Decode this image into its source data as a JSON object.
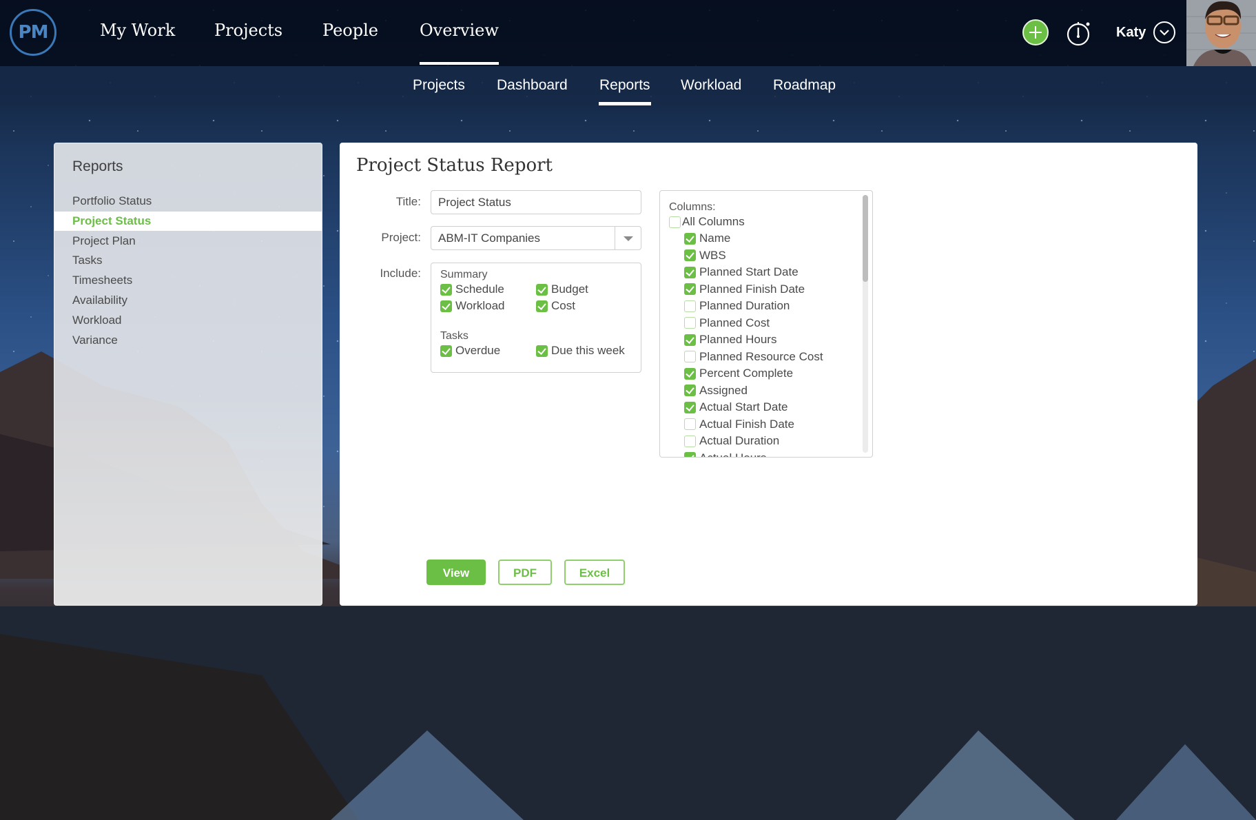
{
  "brand": {
    "logo_text": "PM",
    "accent": "#6cbf45"
  },
  "main_nav": [
    {
      "label": "My Work",
      "active": false
    },
    {
      "label": "Projects",
      "active": false
    },
    {
      "label": "People",
      "active": false
    },
    {
      "label": "Overview",
      "active": true
    }
  ],
  "sub_nav": [
    {
      "label": "Projects",
      "active": false
    },
    {
      "label": "Dashboard",
      "active": false
    },
    {
      "label": "Reports",
      "active": true
    },
    {
      "label": "Workload",
      "active": false
    },
    {
      "label": "Roadmap",
      "active": false
    }
  ],
  "header_actions": {
    "add_icon": "plus-circle-icon",
    "timer_icon": "stopwatch-icon",
    "user_name": "Katy",
    "menu_icon": "chevron-down-circle-icon"
  },
  "sidebar": {
    "title": "Reports",
    "items": [
      {
        "label": "Portfolio Status",
        "active": false
      },
      {
        "label": "Project Status",
        "active": true
      },
      {
        "label": "Project Plan",
        "active": false
      },
      {
        "label": "Tasks",
        "active": false
      },
      {
        "label": "Timesheets",
        "active": false
      },
      {
        "label": "Availability",
        "active": false
      },
      {
        "label": "Workload",
        "active": false
      },
      {
        "label": "Variance",
        "active": false
      }
    ]
  },
  "report": {
    "heading": "Project Status Report",
    "title_label": "Title:",
    "title_value": "Project Status",
    "project_label": "Project:",
    "project_value": "ABM-IT Companies",
    "include_label": "Include:",
    "summary_title": "Summary",
    "summary_options": [
      {
        "label": "Schedule",
        "checked": true
      },
      {
        "label": "Budget",
        "checked": true
      },
      {
        "label": "Workload",
        "checked": true
      },
      {
        "label": "Cost",
        "checked": true
      }
    ],
    "tasks_title": "Tasks",
    "task_options": [
      {
        "label": "Overdue",
        "checked": true
      },
      {
        "label": "Due this week",
        "checked": true
      }
    ],
    "columns_label": "Columns:",
    "all_columns": {
      "label": "All Columns",
      "checked": false
    },
    "columns": [
      {
        "label": "Name",
        "checked": true
      },
      {
        "label": "WBS",
        "checked": true
      },
      {
        "label": "Planned Start Date",
        "checked": true
      },
      {
        "label": "Planned Finish Date",
        "checked": true
      },
      {
        "label": "Planned Duration",
        "checked": false
      },
      {
        "label": "Planned Cost",
        "checked": false
      },
      {
        "label": "Planned Hours",
        "checked": true
      },
      {
        "label": "Planned Resource Cost",
        "checked": false
      },
      {
        "label": "Percent Complete",
        "checked": true
      },
      {
        "label": "Assigned",
        "checked": true
      },
      {
        "label": "Actual Start Date",
        "checked": true
      },
      {
        "label": "Actual Finish Date",
        "checked": false
      },
      {
        "label": "Actual Duration",
        "checked": false
      },
      {
        "label": "Actual Hours",
        "checked": true
      }
    ],
    "buttons": {
      "view": "View",
      "pdf": "PDF",
      "excel": "Excel"
    }
  }
}
